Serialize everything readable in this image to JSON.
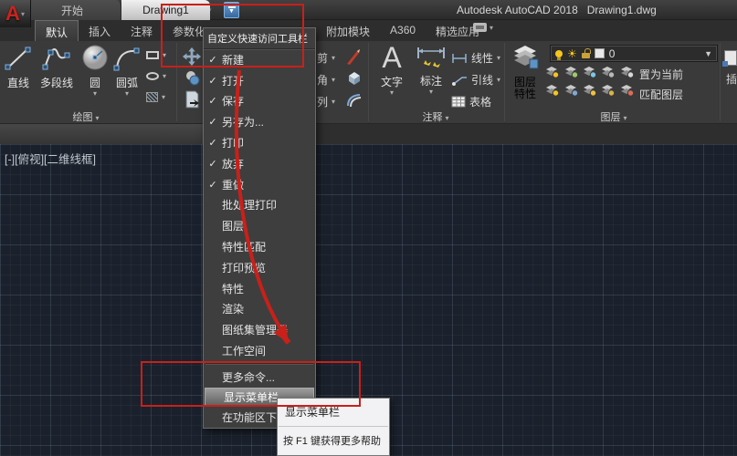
{
  "colors": {
    "annotation_red": "#c9201a",
    "accent_blue": "#4a7ab5",
    "canvas_bg": "#1a212c",
    "menu_bg": "#3e3e3e",
    "tooltip_bg": "#f2f2f4"
  },
  "title_bar": {
    "title": "Autodesk AutoCAD 2018   Drawing1.dwg"
  },
  "qat": {
    "icons": [
      "new-file",
      "open-folder",
      "save",
      "save-as",
      "plot",
      "undo",
      "redo",
      "customize-quick-access"
    ]
  },
  "ribbon": {
    "active_tab": "默认",
    "tabs_left": [
      "默认",
      "插入",
      "注释",
      "参数化"
    ],
    "tabs_right": [
      "附加模块",
      "A360",
      "精选应用"
    ],
    "panels": {
      "draw": {
        "label": "绘图",
        "buttons": [
          {
            "label": "直线"
          },
          {
            "label": "多段线"
          },
          {
            "label": "圆"
          },
          {
            "label": "圆弧"
          }
        ]
      },
      "modify": {
        "small_labels": [
          "剪",
          "角",
          "列"
        ]
      },
      "annotate": {
        "label": "注释",
        "text_button": "文字",
        "dim_button": "标注",
        "rows": [
          "线性",
          "引线",
          "表格"
        ]
      },
      "layers": {
        "label": "图层",
        "big_button_line1": "图层",
        "big_button_line2": "特性",
        "current_layer": "0",
        "row1_label": "置为当前",
        "row2_label": "匹配图层",
        "tool_badges": [
          "#f5c61d",
          "#9fc96a",
          "#7ec4e8",
          "#b9b9b9",
          "#d8d8d8",
          "#f5c61d",
          "#7ea8d8",
          "#f0c040",
          "#d8b24a",
          "#e06a5a"
        ]
      },
      "partial_right": {
        "label_fragment": "插"
      }
    }
  },
  "menu": {
    "title": "自定义快速访问工具栏",
    "items": [
      {
        "label": "新建",
        "checked": true
      },
      {
        "label": "打开",
        "checked": true
      },
      {
        "label": "保存",
        "checked": true
      },
      {
        "label": "另存为...",
        "checked": true
      },
      {
        "label": "打印",
        "checked": true
      },
      {
        "label": "放弃",
        "checked": true
      },
      {
        "label": "重做",
        "checked": true
      },
      {
        "label": "批处理打印",
        "checked": false
      },
      {
        "label": "图层",
        "checked": false
      },
      {
        "label": "特性匹配",
        "checked": false
      },
      {
        "label": "打印预览",
        "checked": false
      },
      {
        "label": "特性",
        "checked": false
      },
      {
        "label": "渲染",
        "checked": false
      },
      {
        "label": "图纸集管理器",
        "checked": false
      },
      {
        "label": "工作空间",
        "checked": false
      },
      {
        "label": "更多命令...",
        "checked": false,
        "separator_before": true
      },
      {
        "label": "显示菜单栏",
        "checked": false,
        "highlighted": true
      },
      {
        "label": "在功能区下方显示",
        "checked": false
      }
    ]
  },
  "tooltip": {
    "title": "显示菜单栏",
    "hint": "按 F1 键获得更多帮助"
  },
  "doc_tabs": {
    "start_label": "开始",
    "active_label": "Drawing1"
  },
  "viewport": {
    "label": "[-][俯视][二维线框]"
  }
}
